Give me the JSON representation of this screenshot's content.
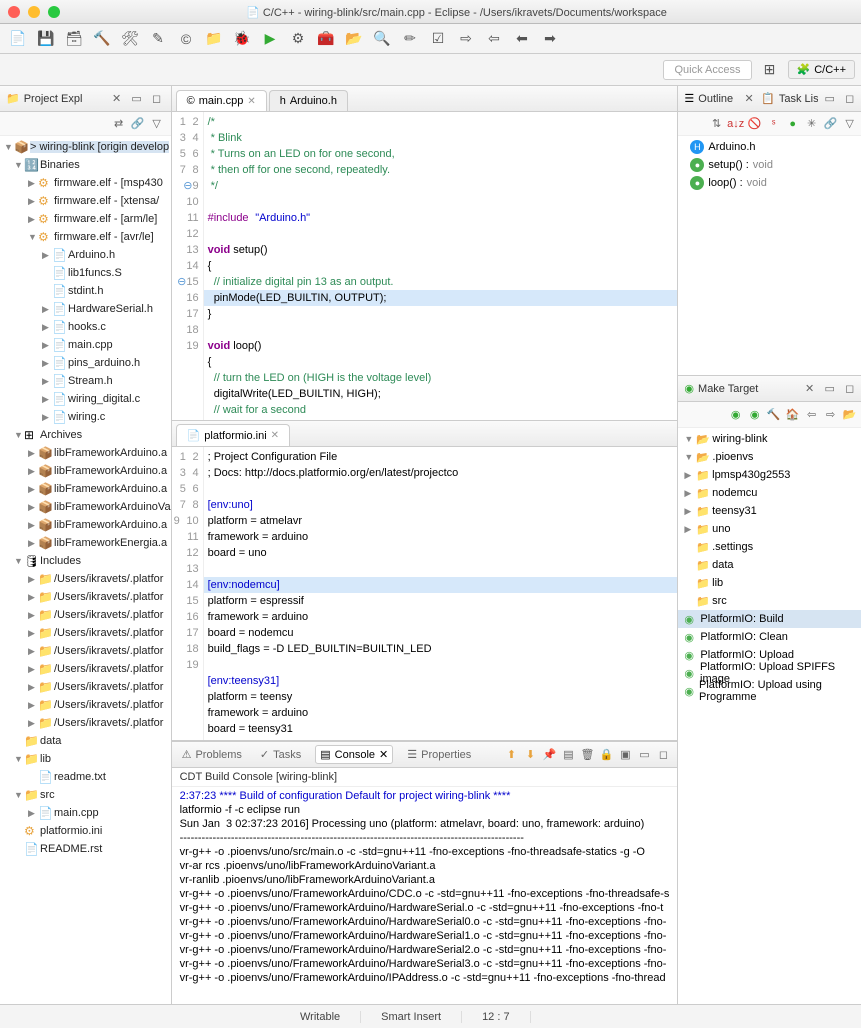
{
  "window": {
    "title": "C/C++ - wiring-blink/src/main.cpp - Eclipse - /Users/ikravets/Documents/workspace"
  },
  "perspective": {
    "quick_access": "Quick Access",
    "current": "C/C++"
  },
  "project_explorer": {
    "title": "Project Expl",
    "root": "> wiring-blink  [origin develop",
    "binaries": "Binaries",
    "fw": [
      "firmware.elf - [msp430",
      "firmware.elf - [xtensa/",
      "firmware.elf - [arm/le]",
      "firmware.elf - [avr/le]"
    ],
    "fw_children": [
      "Arduino.h",
      "lib1funcs.S",
      "stdint.h",
      "HardwareSerial.h",
      "hooks.c",
      "main.cpp",
      "pins_arduino.h",
      "Stream.h",
      "wiring_digital.c",
      "wiring.c"
    ],
    "archives": "Archives",
    "archive_items": [
      "libFrameworkArduino.a",
      "libFrameworkArduino.a",
      "libFrameworkArduino.a",
      "libFrameworkArduinoVa",
      "libFrameworkArduino.a",
      "libFrameworkEnergia.a"
    ],
    "includes": "Includes",
    "include_items": [
      "/Users/ikravets/.platfor",
      "/Users/ikravets/.platfor",
      "/Users/ikravets/.platfor",
      "/Users/ikravets/.platfor",
      "/Users/ikravets/.platfor",
      "/Users/ikravets/.platfor",
      "/Users/ikravets/.platfor",
      "/Users/ikravets/.platfor",
      "/Users/ikravets/.platfor"
    ],
    "folders": [
      "data",
      "lib",
      "src"
    ],
    "lib_file": "readme.txt",
    "src_file": "main.cpp",
    "root_files": [
      "platformio.ini",
      "README.rst"
    ]
  },
  "editors": {
    "main_tab": "main.cpp",
    "arduino_tab": "Arduino.h",
    "main_lines": [
      "1",
      "2",
      "3",
      "4",
      "5",
      "6",
      "7",
      "8",
      "9",
      "10",
      "11",
      "12",
      "13",
      "14",
      "15",
      "16",
      "17",
      "18",
      "19"
    ],
    "main_code": {
      "l1": "/*",
      "l2": " * Blink",
      "l3": " * Turns on an LED on for one second,",
      "l4": " * then off for one second, repeatedly.",
      "l5": " */",
      "l6": "",
      "l7a": "#include",
      "l7b": "\"Arduino.h\"",
      "l8": "",
      "l9a": "void",
      "l9b": " setup()",
      "l10": "{",
      "l11": "  // initialize digital pin 13 as an output.",
      "l12": "  pinMode(LED_BUILTIN, OUTPUT);",
      "l13": "}",
      "l14": "",
      "l15a": "void",
      "l15b": " loop()",
      "l16": "{",
      "l17": "  // turn the LED on (HIGH is the voltage level)",
      "l18": "  digitalWrite(LED_BUILTIN, HIGH);",
      "l19": "  // wait for a second"
    },
    "ini_tab": "platformio.ini",
    "ini_lines": [
      "1",
      "2",
      "3",
      "4",
      "5",
      "6",
      "7",
      "8",
      "9",
      "10",
      "11",
      "12",
      "13",
      "14",
      "15",
      "16",
      "17",
      "18",
      "19"
    ],
    "ini_code": {
      "l1": "; Project Configuration File",
      "l2": "; Docs: http://docs.platformio.org/en/latest/projectco",
      "l3": "",
      "l4": "[env:uno]",
      "l5": "platform = atmelavr",
      "l6": "framework = arduino",
      "l7": "board = uno",
      "l8": "",
      "l9": "[env:nodemcu]",
      "l10": "platform = espressif",
      "l11": "framework = arduino",
      "l12": "board = nodemcu",
      "l13": "build_flags = -D LED_BUILTIN=BUILTIN_LED",
      "l14": "",
      "l15": "[env:teensy31]",
      "l16": "platform = teensy",
      "l17": "framework = arduino",
      "l18": "board = teensy31",
      "l19": ""
    }
  },
  "outline": {
    "title": "Outline",
    "tasklist": "Task List",
    "items": [
      {
        "icon": "blue",
        "label": "Arduino.h",
        "ret": ""
      },
      {
        "icon": "green",
        "label": "setup() : ",
        "ret": "void"
      },
      {
        "icon": "green",
        "label": "loop() : ",
        "ret": "void"
      }
    ]
  },
  "make_target": {
    "title": "Make Target",
    "root": "wiring-blink",
    "pio": ".pioenvs",
    "pio_children": [
      "lpmsp430g2553",
      "nodemcu",
      "teensy31",
      "uno"
    ],
    "folders": [
      ".settings",
      "data",
      "lib",
      "src"
    ],
    "targets": [
      "PlatformIO: Build",
      "PlatformIO: Clean",
      "PlatformIO: Upload",
      "PlatformIO: Upload SPIFFS image",
      "PlatformIO: Upload using Programme"
    ]
  },
  "bottom": {
    "problems": "Problems",
    "tasks": "Tasks",
    "console": "Console",
    "properties": "Properties",
    "console_title": "CDT Build Console [wiring-blink]",
    "out_blue": "2:37:23 **** Build of configuration Default for project wiring-blink ****",
    "out": "latformio -f -c eclipse run\nSun Jan  3 02:37:23 2016] Processing uno (platform: atmelavr, board: uno, framework: arduino)\n----------------------------------------------------------------------------------------------\nvr-g++ -o .pioenvs/uno/src/main.o -c -std=gnu++11 -fno-exceptions -fno-threadsafe-statics -g -O\nvr-ar rcs .pioenvs/uno/libFrameworkArduinoVariant.a\nvr-ranlib .pioenvs/uno/libFrameworkArduinoVariant.a\nvr-g++ -o .pioenvs/uno/FrameworkArduino/CDC.o -c -std=gnu++11 -fno-exceptions -fno-threadsafe-s\nvr-g++ -o .pioenvs/uno/FrameworkArduino/HardwareSerial.o -c -std=gnu++11 -fno-exceptions -fno-t\nvr-g++ -o .pioenvs/uno/FrameworkArduino/HardwareSerial0.o -c -std=gnu++11 -fno-exceptions -fno-\nvr-g++ -o .pioenvs/uno/FrameworkArduino/HardwareSerial1.o -c -std=gnu++11 -fno-exceptions -fno-\nvr-g++ -o .pioenvs/uno/FrameworkArduino/HardwareSerial2.o -c -std=gnu++11 -fno-exceptions -fno-\nvr-g++ -o .pioenvs/uno/FrameworkArduino/HardwareSerial3.o -c -std=gnu++11 -fno-exceptions -fno-\nvr-g++ -o .pioenvs/uno/FrameworkArduino/IPAddress.o -c -std=gnu++11 -fno-exceptions -fno-thread"
  },
  "status": {
    "writable": "Writable",
    "smart": "Smart Insert",
    "pos": "12 : 7"
  }
}
